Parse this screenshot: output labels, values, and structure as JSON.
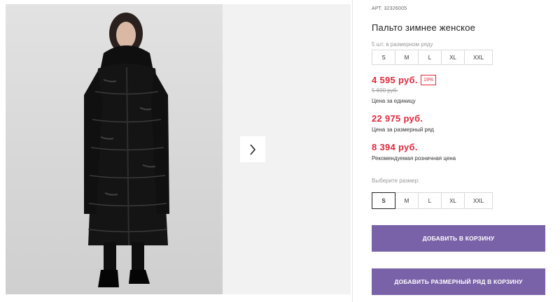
{
  "product": {
    "art_label": "АРТ.",
    "art_number": "32326005",
    "title": "Пальто зимнее женское"
  },
  "pack": {
    "note": "5 шт. в размерном ряду",
    "sizes": [
      "S",
      "M",
      "L",
      "XL",
      "XXL"
    ]
  },
  "pricing": {
    "unit_price": "4 595 руб.",
    "discount": "19%",
    "old_price": "5 690 руб.",
    "unit_label": "Цена за единицу",
    "pack_price": "22 975 руб.",
    "pack_label": "Цена за размерный ряд",
    "retail_price": "8 394 руб.",
    "retail_label": "Рекомендуемая розничная цена"
  },
  "size_select": {
    "label": "Выберите размер:",
    "options": [
      "S",
      "M",
      "L",
      "XL",
      "XXL"
    ],
    "selected": "S"
  },
  "actions": {
    "add_to_cart": "Добавить в корзину",
    "add_pack_to_cart": "Добавить размерный ряд в корзину"
  },
  "gallery": {
    "next_icon": "chevron-right-icon"
  },
  "colors": {
    "accent": "#7a62a8",
    "price": "#e0283a"
  }
}
